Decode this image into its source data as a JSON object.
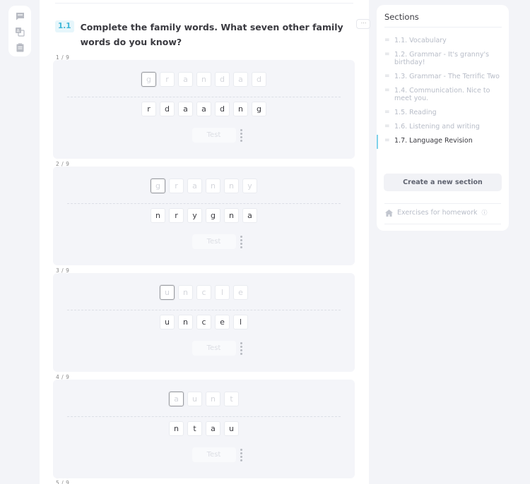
{
  "toolbar": {
    "icons": [
      "comment-icon",
      "translate-icon",
      "clipboard-icon"
    ]
  },
  "exercise": {
    "number": "1.1",
    "title": "Complete the family words. What seven other family words do you know?",
    "more_label": "⋯"
  },
  "tasks": [
    {
      "label": "1 / 9",
      "answer": [
        "g",
        "r",
        "a",
        "n",
        "d",
        "a",
        "d"
      ],
      "letters": [
        "r",
        "d",
        "a",
        "a",
        "d",
        "n",
        "g"
      ],
      "test_label": "Test"
    },
    {
      "label": "2 / 9",
      "answer": [
        "g",
        "r",
        "a",
        "n",
        "n",
        "y"
      ],
      "letters": [
        "n",
        "r",
        "y",
        "g",
        "n",
        "a"
      ],
      "test_label": "Test"
    },
    {
      "label": "3 / 9",
      "answer": [
        "u",
        "n",
        "c",
        "l",
        "e"
      ],
      "letters": [
        "u",
        "n",
        "c",
        "e",
        "l"
      ],
      "test_label": "Test"
    },
    {
      "label": "4 / 9",
      "answer": [
        "a",
        "u",
        "n",
        "t"
      ],
      "letters": [
        "n",
        "t",
        "a",
        "u"
      ],
      "test_label": "Test"
    }
  ],
  "next_task_label": "5 / 9",
  "sections": {
    "title": "Sections",
    "items": [
      {
        "label": "1.1. Vocabulary",
        "active": false
      },
      {
        "label": "1.2. Grammar - It's granny's birthday!",
        "active": false
      },
      {
        "label": "1.3. Grammar - The Terrific Two",
        "active": false
      },
      {
        "label": "1.4. Communication. Nice to meet you.",
        "active": false
      },
      {
        "label": "1.5. Reading",
        "active": false
      },
      {
        "label": "1.6. Listening and writing",
        "active": false
      },
      {
        "label": "1.7. Language Revision",
        "active": true
      }
    ],
    "create_label": "Create a new section",
    "homework_label": "Exercises for homework",
    "homework_info": "ⓘ"
  },
  "colors": {
    "accent": "#3cb6d8",
    "active_bar": "#7fd2ea"
  }
}
